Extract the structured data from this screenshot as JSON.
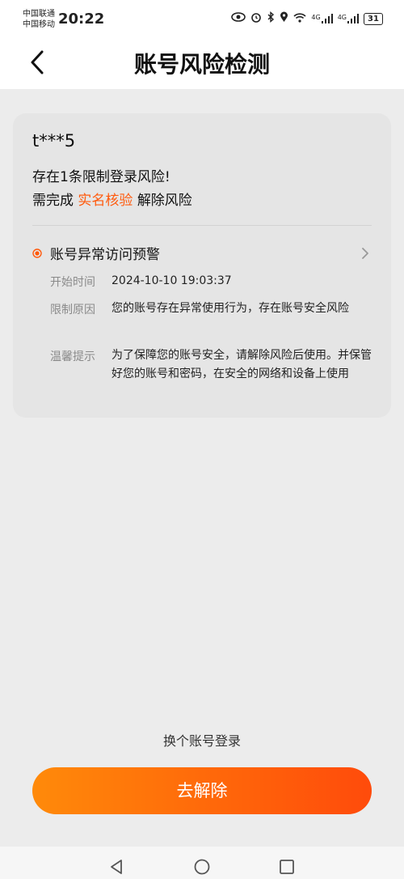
{
  "status": {
    "carrier1": "中国联通",
    "carrier2": "中国移动",
    "time": "20:22",
    "net1": "4G",
    "net2": "4G",
    "battery": "31"
  },
  "header": {
    "title": "账号风险检测"
  },
  "card": {
    "account": "t***5",
    "risk_text": "存在1条限制登录风险!",
    "require_prefix": "需完成",
    "require_link": "实名核验",
    "require_suffix": "解除风险",
    "alert": {
      "title": "账号异常访问预警",
      "rows": [
        {
          "label": "开始时间",
          "value": "2024-10-10 19:03:37"
        },
        {
          "label": "限制原因",
          "value": "您的账号存在异常使用行为，存在账号安全风险"
        },
        {
          "label": "温馨提示",
          "value": "为了保障您的账号安全，请解除风险后使用。并保管好您的账号和密码，在安全的网络和设备上使用"
        }
      ]
    }
  },
  "footer": {
    "switch_account": "换个账号登录",
    "resolve_button": "去解除"
  },
  "colors": {
    "accent": "#ff5a0d",
    "button_start": "#ff8a0a",
    "button_end": "#ff4b0b"
  }
}
